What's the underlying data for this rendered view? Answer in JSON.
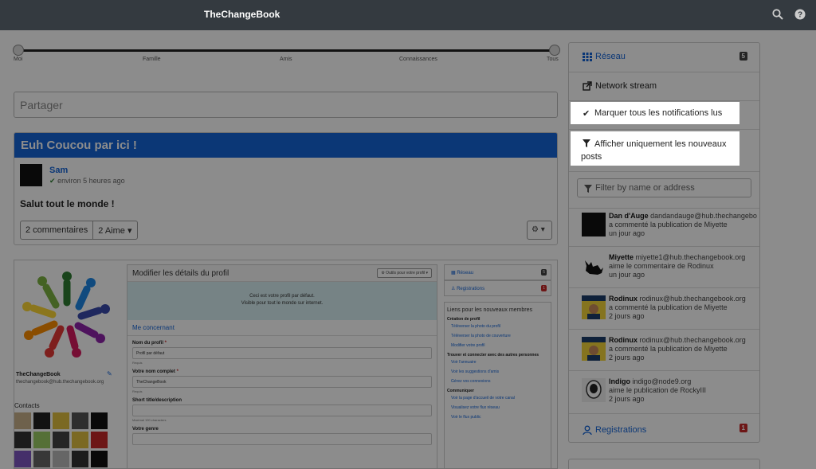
{
  "navbar": {
    "brand": "TheChangeBook",
    "icons": [
      "search-icon",
      "help-icon"
    ]
  },
  "slider": {
    "labels": [
      "Moi",
      "Famille",
      "Amis",
      "Connaissances",
      "Tous"
    ]
  },
  "share": {
    "placeholder": "Partager"
  },
  "post": {
    "title": "Euh Coucou par ici !",
    "author": "Sam",
    "time": "environ 5 heures ago",
    "body": "Salut tout le monde !",
    "comments": "2 commentaires",
    "likes": "2 Aime",
    "likes_caret": "▾",
    "gear": "⚙ ▾"
  },
  "embed": {
    "profile_name": "TheChangeBook",
    "profile_address": "thechangebook@hub.thechangebook.org",
    "contacts_label": "Contacts",
    "title": "Modifier les détails du profil",
    "tools": "⚙ Outils pour votre profil ▾",
    "info_line1": "Ceci est votre profil par défaut.",
    "info_line2": "Visible pour tout le monde sur internet.",
    "section": "Me concernant",
    "field1_label": "Nom du profil",
    "field1_value": "Profil par défaut",
    "field1_help": "Requis",
    "field2_label": "Votre nom complet",
    "field2_value": "TheChangeBook",
    "field2_help": "Requis",
    "field3_label": "Short title/description",
    "field3_help": "Maximal 190 characters",
    "field4_label": "Votre genre",
    "side_item1": "Réseau",
    "side_item1_badge": "5",
    "side_item2": "Registrations",
    "side_item2_badge": "1",
    "links_title": "Liens pour les nouveaux membres",
    "links": [
      {
        "h": "Création de profil"
      },
      {
        "a": "Téléverser la photo du profil"
      },
      {
        "a": "Téléverser la photo de couverture"
      },
      {
        "a": "Modifier votre profil"
      },
      {
        "h": "Trouver et connecter avec des autres personnes"
      },
      {
        "a": "Voir l'annuaire"
      },
      {
        "a": "Voir les suggestions d'amis"
      },
      {
        "a": "Gérez vos connexions"
      },
      {
        "h": "Communiquer"
      },
      {
        "a": "Voir la page d'accueil de votre canal"
      },
      {
        "a": "Visualisez votre flux réseau"
      },
      {
        "a": "Voir le flux public"
      }
    ]
  },
  "sidebar": {
    "reseau": "Réseau",
    "reseau_badge": "5",
    "network_stream": "Network stream",
    "mark_all": "Marquer tous les notifications lus",
    "only_new": "Afficher uniquement les nouveaux posts",
    "filter_placeholder": "Filter by name or address",
    "registrations": "Registrations",
    "registrations_badge": "1",
    "notifications": [
      {
        "name": "Dan d'Auge",
        "addr": "dandandauge@hub.thechangebook.org",
        "action": "a commenté la publication de Miyette",
        "time": "un jour ago"
      },
      {
        "name": "Miyette",
        "addr": "miyette1@hub.thechangebook.org",
        "action": "aime le commentaire de Rodinux",
        "time": "un jour ago"
      },
      {
        "name": "Rodinux",
        "addr": "rodinux@hub.thechangebook.org",
        "action": "a commenté la publication de Miyette",
        "time": "2 jours ago"
      },
      {
        "name": "Rodinux",
        "addr": "rodinux@hub.thechangebook.org",
        "action": "a commenté la publication de Miyette",
        "time": "2 jours ago"
      },
      {
        "name": "Indigo",
        "addr": "indigo@node9.org",
        "action": "aime le publication de RockyIII",
        "time": "2 jours ago"
      }
    ]
  },
  "colors": {
    "accent": "#1565d8",
    "navbar": "#343a40",
    "badge_dark": "#444444",
    "badge_red": "#c62828"
  }
}
